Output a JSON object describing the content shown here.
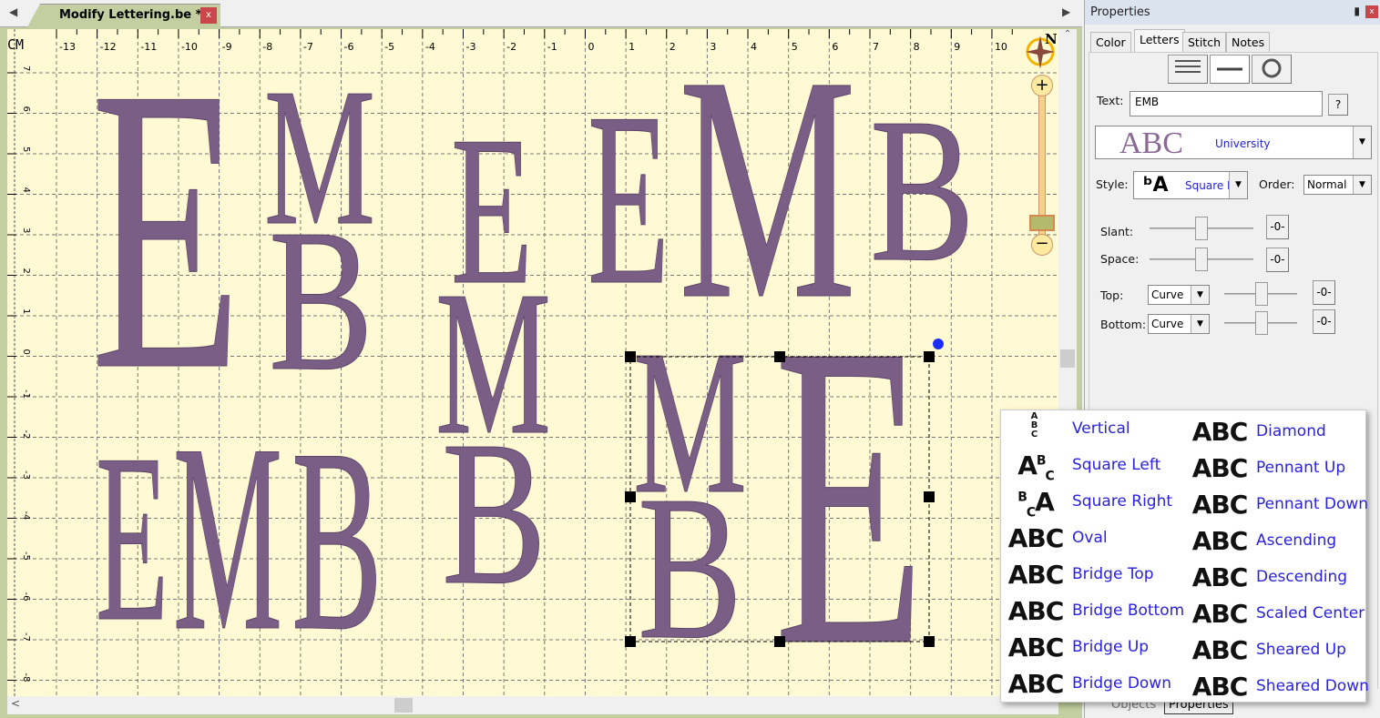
{
  "document_tab": {
    "title": "Modify Lettering.be *",
    "close": "x"
  },
  "ruler": {
    "unit": "CM",
    "x_labels": [
      "-13",
      "-12",
      "-11",
      "-10",
      "-9",
      "-8",
      "-7",
      "-6",
      "-5",
      "-4",
      "-3",
      "-2",
      "-1",
      "0",
      "1",
      "2",
      "3",
      "4",
      "5",
      "6",
      "7",
      "8",
      "9",
      "10"
    ],
    "y_labels": [
      "7",
      "6",
      "5",
      "4",
      "3",
      "2",
      "1",
      "0",
      "-1",
      "-2",
      "-3",
      "-4",
      "-5",
      "-6",
      "-7",
      "-8"
    ]
  },
  "compass": {
    "label": "N"
  },
  "zoom_slider": {
    "level": 0.05
  },
  "canvas": {
    "thread_color": "#7b5e86",
    "monograms": [
      [
        "E",
        "M",
        "B"
      ],
      [
        "E",
        "M",
        "B"
      ],
      [
        "E",
        "M",
        "B"
      ],
      [
        "E",
        "M",
        "B"
      ],
      [
        "M",
        "B",
        "E"
      ]
    ]
  },
  "properties": {
    "title": "Properties",
    "pin": "❠",
    "close": "x",
    "tabs": [
      "Color",
      "Letters",
      "Stitch",
      "Notes"
    ],
    "active_tab": "Letters",
    "text_label": "Text:",
    "text_value": "EMB",
    "help": "?",
    "font_preview": "ABC",
    "font_name": "University",
    "style_label": "Style:",
    "style_value": "Square I",
    "order_label": "Order:",
    "order_value": "Normal",
    "slant_label": "Slant:",
    "slant_value": "-0-",
    "space_label": "Space:",
    "space_value": "-0-",
    "top_label": "Top:",
    "top_value": "Curve",
    "top_amount": "-0-",
    "bottom_label": "Bottom:",
    "bottom_value": "Curve",
    "bottom_amount": "-0-"
  },
  "style_menu": {
    "left": [
      "Vertical",
      "Square Left",
      "Square Right",
      "Oval",
      "Bridge Top",
      "Bridge Bottom",
      "Bridge Up",
      "Bridge Down"
    ],
    "right": [
      "Diamond",
      "Pennant Up",
      "Pennant Down",
      "Ascending",
      "Descending",
      "Scaled Center",
      "Sheared Up",
      "Sheared Down"
    ]
  },
  "bottom_tabs": [
    "Objects",
    "Properties"
  ]
}
